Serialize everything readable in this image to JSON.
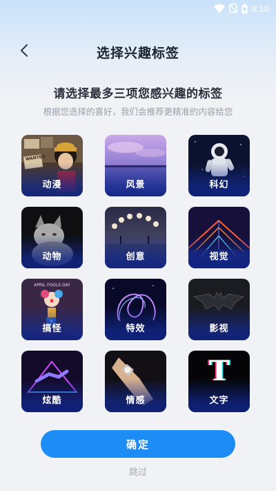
{
  "status_bar": {
    "time": "9:10"
  },
  "header": {
    "title": "选择兴趣标签"
  },
  "intro": {
    "headline": "请选择最多三项您感兴趣的标签",
    "subline": "根据您选择的喜好，我们会推荐更精准的内容给您"
  },
  "tags": [
    {
      "label": "动漫",
      "icon": "anime-thumbnail"
    },
    {
      "label": "风景",
      "icon": "landscape-thumbnail"
    },
    {
      "label": "科幻",
      "icon": "astronaut-thumbnail"
    },
    {
      "label": "动物",
      "icon": "cat-thumbnail"
    },
    {
      "label": "创意",
      "icon": "moon-phases-thumbnail"
    },
    {
      "label": "视觉",
      "icon": "neon-corridor-thumbnail"
    },
    {
      "label": "搞怪",
      "icon": "clown-thumbnail"
    },
    {
      "label": "特效",
      "icon": "glow-swirl-thumbnail"
    },
    {
      "label": "影视",
      "icon": "bat-logo-thumbnail"
    },
    {
      "label": "炫酷",
      "icon": "neon-hand-thumbnail"
    },
    {
      "label": "情感",
      "icon": "hand-watch-thumbnail"
    },
    {
      "label": "文字",
      "icon": "letter-t-thumbnail"
    }
  ],
  "tag_overlay_text": {
    "wanted": "WANTED",
    "april": "APRIL FOOLS DAY",
    "letter": "T"
  },
  "actions": {
    "confirm": "确定",
    "skip": "跳过"
  },
  "colors": {
    "accent": "#1e8cf5",
    "title": "#1c2433",
    "muted": "#9aa0aa"
  }
}
